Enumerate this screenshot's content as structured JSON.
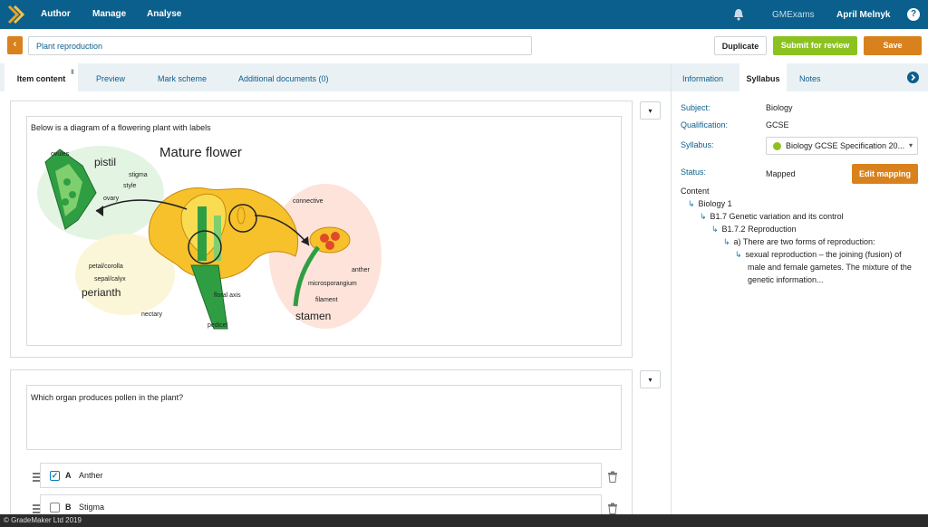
{
  "nav": {
    "author": "Author",
    "manage": "Manage",
    "analyse": "Analyse",
    "org": "GMExams",
    "user": "April Melnyk",
    "help": "?"
  },
  "header": {
    "back": "‹",
    "title": "Plant reproduction",
    "duplicate": "Duplicate",
    "submit": "Submit for review",
    "save": "Save"
  },
  "tabs": [
    "Item content",
    "Preview",
    "Mark scheme",
    "Additional documents (0)"
  ],
  "side_tabs": [
    "Information",
    "Syllabus",
    "Notes"
  ],
  "stem": {
    "text": "Below is a diagram of a flowering plant with labels"
  },
  "diagram": {
    "title": "Mature flower",
    "labels": [
      "ovules",
      "pistil",
      "stigma",
      "style",
      "ovary",
      "connective",
      "petal/corolla",
      "sepal/calyx",
      "perianth",
      "anther",
      "microsporangium",
      "filament",
      "stamen",
      "floral axis",
      "nectary",
      "pedicel"
    ]
  },
  "question": {
    "text": "Which organ produces pollen in the plant?"
  },
  "options": [
    {
      "letter": "A",
      "text": "Anther",
      "checked": true
    },
    {
      "letter": "B",
      "text": "Stigma",
      "checked": false
    }
  ],
  "syllabus": {
    "subject_label": "Subject:",
    "subject": "Biology",
    "qual_label": "Qualification:",
    "qual": "GCSE",
    "syllabus_label": "Syllabus:",
    "syllabus": "Biology GCSE Specification 20...",
    "status_label": "Status:",
    "status": "Mapped",
    "edit": "Edit mapping",
    "content_label": "Content",
    "tree": [
      "Biology 1",
      "B1.7 Genetic variation and its control",
      "B1.7.2 Reproduction",
      "a) There are two forms of reproduction:",
      "sexual reproduction – the joining (fusion) of",
      "male and female gametes. The mixture of the",
      "genetic information..."
    ]
  },
  "footer": "© GradeMaker Ltd 2019",
  "colors": {
    "primary": "#0b5f8c",
    "accent": "#d9821d",
    "green": "#8cc220"
  }
}
